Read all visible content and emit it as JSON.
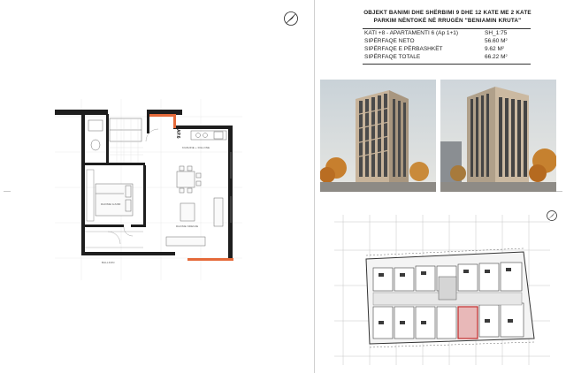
{
  "title": {
    "line1": "OBJEKT BANIMI DHE SHËRBIMI 9 DHE 12 KATE ME 2 KATE",
    "line2": "PARKIM NËNTOKË NË RRUGËN \"BENIAMIN KRUTA\""
  },
  "unit": {
    "floor_apartment": "KATI +8 - APARTAMENTI 6  (Ap 1+1)",
    "sheet_code": "SH_1:75"
  },
  "areas": [
    {
      "label": "SIPËRFAQE NETO",
      "value": "56.60 M",
      "unit_exp": "2"
    },
    {
      "label": "SIPËRFAQE E PËRBASHKËT",
      "value": "9.62 M",
      "unit_exp": "2"
    },
    {
      "label": "SIPËRFAQE TOTALE",
      "value": "66.22 M",
      "unit_exp": "2"
    }
  ],
  "plan": {
    "apartment_tag": "AP.6",
    "rooms": {
      "kitchen": "KUZHINE + DILLONE",
      "bedroom": "DHOME GJUMI",
      "living": "DHOME NDENJE",
      "balcony": "BALLKON"
    }
  },
  "colors": {
    "wall": "#1e1e1e",
    "highlight": "#e56a3a",
    "keyplan_highlight": "#d04848",
    "sky": "#d7dde2",
    "facade": "#c9b8a2"
  },
  "icons": [
    "north-arrow-icon",
    "north-arrow-small-icon"
  ]
}
